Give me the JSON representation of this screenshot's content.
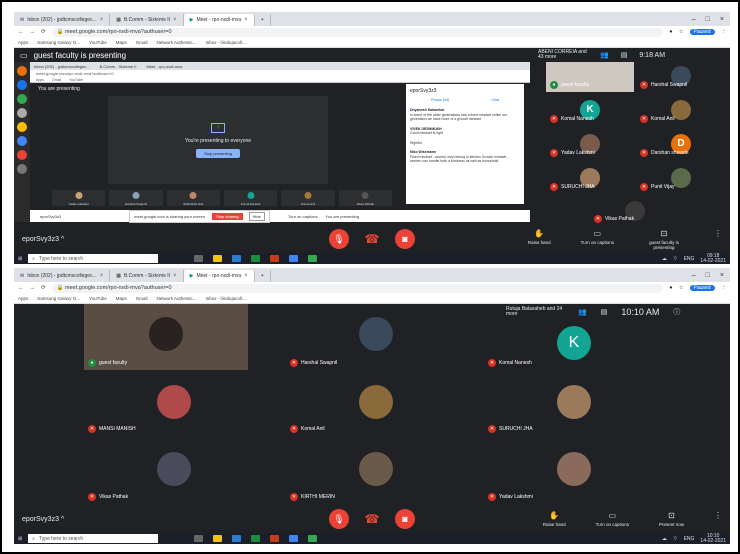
{
  "screen1": {
    "browser": {
      "tabs": [
        "Inbox (202) - jpdtcmscollegec...",
        "B.Comm - Sixteme II",
        "Meet - rpo-nxdi-mva"
      ],
      "url": "meet.google.com/rpo-nxdi-mva?authuser=0",
      "profile": "Paused",
      "bookmarks": [
        "Apps",
        "Samsung Galaxy O...",
        "YouTube",
        "Maps",
        "Gmail",
        "Network Authentic...",
        "Inbox - hindujacoll..."
      ]
    },
    "banner": "guest faculty is presenting",
    "presenter_chip": "ABENI CORREIA and 43 more",
    "clock": "9:18 AM",
    "remote": {
      "you_are_presenting": "You are presenting",
      "presenting_text": "You're presenting to everyone",
      "stop_button": "Stop presenting",
      "chat_title": "eporSvy3z3",
      "chat_tabs": [
        "People (54)",
        "Chat"
      ],
      "chat_messages": [
        {
          "name": "Dnyanesh Sakarekar",
          "text": "in some of the older generations has a fixed mindset unlike our generation we have more of a growth mindset"
        },
        {
          "name": "VIVEK DESHMUKH",
          "text": "Good mindset is right"
        },
        {
          "name": "",
          "text": "Rightful"
        },
        {
          "name": "Niko Wisemann",
          "text": "Fixed mindset - women only belong in kitchen Growth mindset - women can handle both a business as well as household"
        }
      ],
      "strip": [
        "Yadav Lakshmi",
        "Harshal Swapnil",
        "SURUCHI JHA",
        "Komal Nanesh",
        "Komal Anil",
        "Vikas Pathak"
      ],
      "code": "eporSvy3z3",
      "notice": "meet.google.com is sharing your screen.",
      "notice_stop": "Stop sharing",
      "notice_hide": "Hide",
      "turn_on_captions": "Turn on captions",
      "you_are_presenting2": "You are presenting"
    },
    "grid": [
      {
        "name": "guest faculty",
        "initial": "",
        "color": "#5f6368"
      },
      {
        "name": "Harshal Swapnil",
        "initial": "",
        "color": "#3a4a5c"
      },
      {
        "name": "Komal Nanesh",
        "initial": "K",
        "color": "#12a594"
      },
      {
        "name": "Komal Anil",
        "initial": "",
        "color": "#8a6a3a"
      },
      {
        "name": "Yadav Lakshmi",
        "initial": "",
        "color": "#7a5a4a"
      },
      {
        "name": "Darshan shivade",
        "initial": "D",
        "color": "#e8710a"
      },
      {
        "name": "SURUCHI JHA",
        "initial": "",
        "color": "#9a7a5a"
      },
      {
        "name": "Punit Vijay",
        "initial": "",
        "color": "#5a6a4a"
      },
      {
        "name": "Vikas Pathak",
        "initial": "",
        "color": "#3a3a3a"
      }
    ],
    "meeting_code": "eporSvy3z3",
    "controls": {
      "raise_hand": "Raise hand",
      "captions": "Turn on captions",
      "presenting": "guest faculty is presenting"
    },
    "taskbar": {
      "search": "Type here to search",
      "time": "09:18",
      "date": "14-02-2021",
      "lang": "ENG"
    }
  },
  "screen2": {
    "browser": {
      "tabs": [
        "Inbox (202) - jpdtcmscollegec...",
        "B.Comm - Sixteme II",
        "Meet - rpo-nxdi-mva"
      ],
      "url": "meet.google.com/rpo-nxdi-mva?authuser=0",
      "profile": "Paused",
      "bookmarks": [
        "Apps",
        "Samsung Galaxy O...",
        "YouTube",
        "Maps",
        "Gmail",
        "Network Authentic...",
        "Inbox - hindujacoll..."
      ]
    },
    "presenter_chip": "Rutuja Balasaheb and 24 more",
    "clock": "10:10 AM",
    "grid": [
      {
        "name": "guest faculty",
        "initial": "",
        "color": "#6a5a4a"
      },
      {
        "name": "Harshal Swapnil",
        "initial": "",
        "color": "#3a4a5c"
      },
      {
        "name": "Komal Nanesh",
        "initial": "K",
        "color": "#12a594"
      },
      {
        "name": "MANSI MANISH",
        "initial": "",
        "color": "#b04a4a"
      },
      {
        "name": "Komal Anil",
        "initial": "",
        "color": "#8a6a3a"
      },
      {
        "name": "SURUCHI JHA",
        "initial": "",
        "color": "#9a7a5a"
      },
      {
        "name": "Vikas Pathak",
        "initial": "",
        "color": "#4a4a5a"
      },
      {
        "name": "KIRTHI MERIN",
        "initial": "",
        "color": "#6a5a4a"
      },
      {
        "name": "Yadav Lakshmi",
        "initial": "",
        "color": "#8a6a5a"
      }
    ],
    "meeting_code": "eporSvy3z3",
    "controls": {
      "raise_hand": "Raise hand",
      "captions": "Turn on captions",
      "present": "Present now"
    },
    "taskbar": {
      "search": "Type here to search",
      "time": "10:10",
      "date": "14-02-2021",
      "lang": "ENG"
    }
  },
  "colors": {
    "meet_bg": "#202124",
    "tile_bg": "#3c4043",
    "end_call": "#ea4335",
    "accent": "#8ab4f8"
  }
}
